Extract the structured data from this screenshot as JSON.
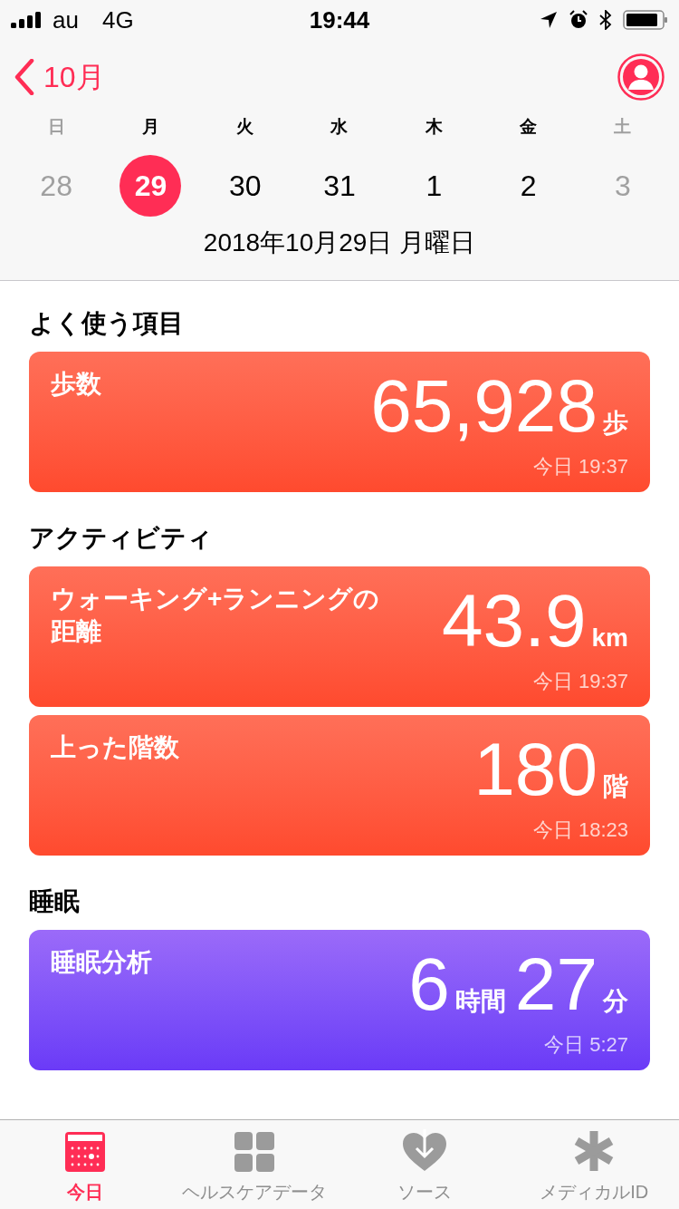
{
  "status_bar": {
    "carrier": "au",
    "network": "4G",
    "time": "19:44"
  },
  "nav": {
    "back_label": "10月"
  },
  "week": [
    {
      "weekday": "日",
      "day": "28",
      "selected": false,
      "muted": true
    },
    {
      "weekday": "月",
      "day": "29",
      "selected": true,
      "muted": false
    },
    {
      "weekday": "火",
      "day": "30",
      "selected": false,
      "muted": false
    },
    {
      "weekday": "水",
      "day": "31",
      "selected": false,
      "muted": false
    },
    {
      "weekday": "木",
      "day": "1",
      "selected": false,
      "muted": false
    },
    {
      "weekday": "金",
      "day": "2",
      "selected": false,
      "muted": false
    },
    {
      "weekday": "土",
      "day": "3",
      "selected": false,
      "muted": true
    }
  ],
  "date_label": "2018年10月29日 月曜日",
  "sections": [
    {
      "title": "よく使う項目",
      "cards": [
        {
          "kind": "activity",
          "title": "歩数",
          "value": [
            {
              "kind": "number",
              "text": "65,928"
            },
            {
              "kind": "unit",
              "text": "歩"
            }
          ],
          "time": "今日 19:37"
        }
      ]
    },
    {
      "title": "アクティビティ",
      "cards": [
        {
          "kind": "activity",
          "title": "ウォーキング+ランニングの距離",
          "value": [
            {
              "kind": "number",
              "text": "43.9"
            },
            {
              "kind": "unit",
              "text": "km"
            }
          ],
          "time": "今日 19:37"
        },
        {
          "kind": "activity",
          "title": "上った階数",
          "value": [
            {
              "kind": "number",
              "text": "180"
            },
            {
              "kind": "unit",
              "text": "階"
            }
          ],
          "time": "今日 18:23"
        }
      ]
    },
    {
      "title": "睡眠",
      "cards": [
        {
          "kind": "sleep",
          "title": "睡眠分析",
          "value": [
            {
              "kind": "number",
              "text": "6"
            },
            {
              "kind": "unit",
              "text": "時間"
            },
            {
              "kind": "number",
              "text": "27"
            },
            {
              "kind": "unit",
              "text": "分"
            }
          ],
          "time": "今日 5:27"
        }
      ]
    }
  ],
  "tabs": [
    {
      "kind": "today",
      "label": "今日",
      "selected": true
    },
    {
      "kind": "data",
      "label": "ヘルスケアデータ",
      "selected": false
    },
    {
      "kind": "sources",
      "label": "ソース",
      "selected": false
    },
    {
      "kind": "medical",
      "label": "メディカルID",
      "selected": false
    }
  ]
}
